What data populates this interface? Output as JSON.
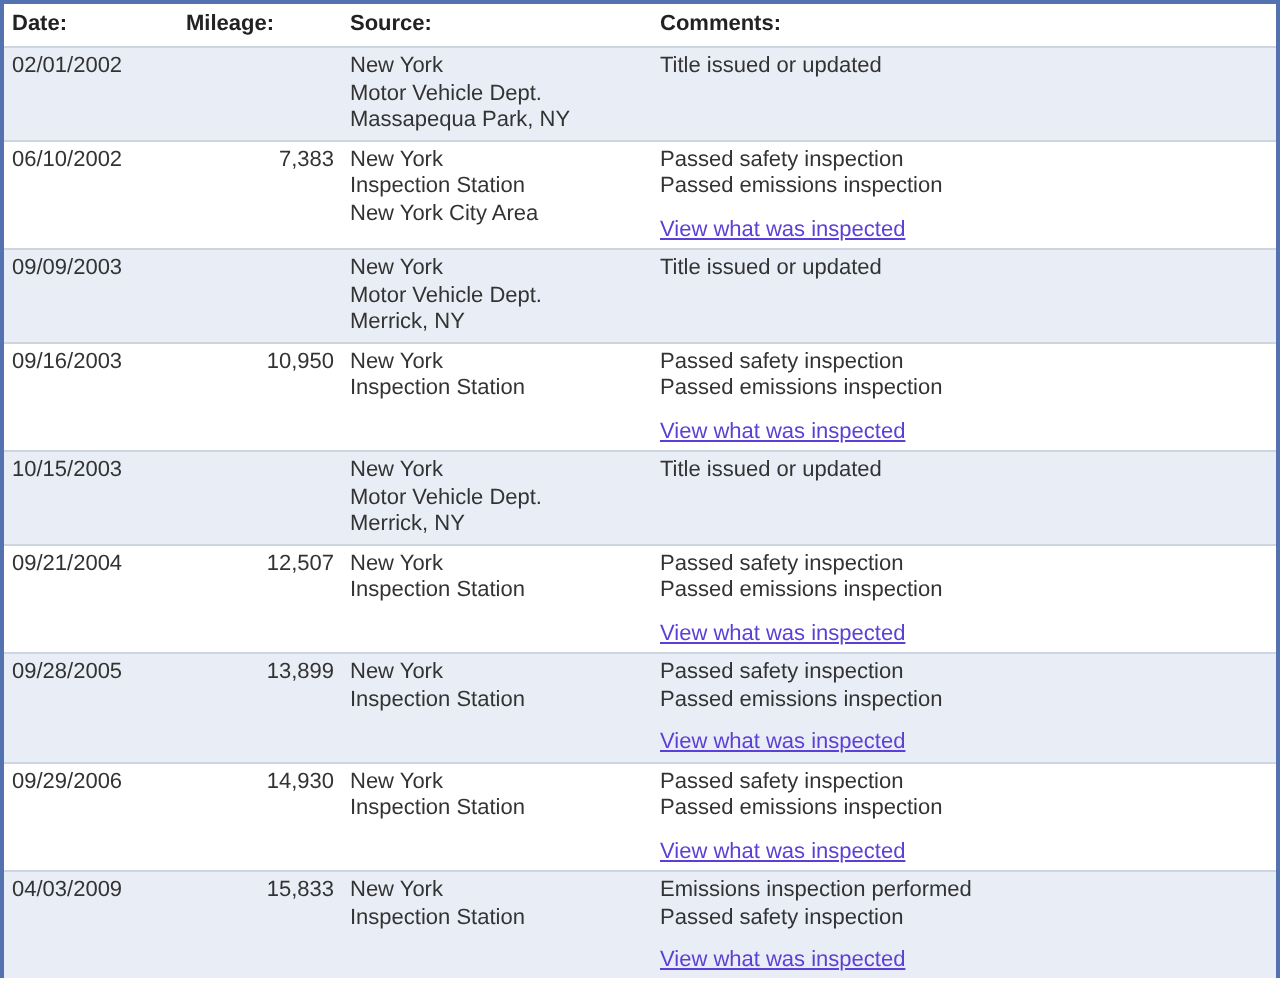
{
  "table": {
    "columns": [
      "Date:",
      "Mileage:",
      "Source:",
      "Comments:"
    ],
    "rows": [
      {
        "date": "02/01/2002",
        "source": [
          "New York",
          "Motor Vehicle Dept.",
          "Massapequa Park, NY"
        ],
        "comments": [
          "Title issued or updated"
        ]
      },
      {
        "date": "06/10/2002",
        "mileage": "7,383",
        "source": [
          "New York",
          "Inspection Station",
          "New York City Area"
        ],
        "comments": [
          "Passed safety inspection",
          "Passed emissions inspection"
        ],
        "link": "View what was inspected"
      },
      {
        "date": "09/09/2003",
        "source": [
          "New York",
          "Motor Vehicle Dept.",
          "Merrick, NY"
        ],
        "comments": [
          "Title issued or updated"
        ]
      },
      {
        "date": "09/16/2003",
        "mileage": "10,950",
        "source": [
          "New York",
          "Inspection Station"
        ],
        "comments": [
          "Passed safety inspection",
          "Passed emissions inspection"
        ],
        "link": "View what was inspected"
      },
      {
        "date": "10/15/2003",
        "source": [
          "New York",
          "Motor Vehicle Dept.",
          "Merrick, NY"
        ],
        "comments": [
          "Title issued or updated"
        ]
      },
      {
        "date": "09/21/2004",
        "mileage": "12,507",
        "source": [
          "New York",
          "Inspection Station"
        ],
        "comments": [
          "Passed safety inspection",
          "Passed emissions inspection"
        ],
        "link": "View what was inspected"
      },
      {
        "date": "09/28/2005",
        "mileage": "13,899",
        "source": [
          "New York",
          "Inspection Station"
        ],
        "comments": [
          "Passed safety inspection",
          "Passed emissions inspection"
        ],
        "link": "View what was inspected"
      },
      {
        "date": "09/29/2006",
        "mileage": "14,930",
        "source": [
          "New York",
          "Inspection Station"
        ],
        "comments": [
          "Passed safety inspection",
          "Passed emissions inspection"
        ],
        "link": "View what was inspected"
      },
      {
        "date": "04/03/2009",
        "mileage": "15,833",
        "source": [
          "New York",
          "Inspection Station"
        ],
        "comments": [
          "Emissions inspection performed",
          "Passed safety inspection"
        ],
        "link": "View what was inspected"
      }
    ]
  }
}
